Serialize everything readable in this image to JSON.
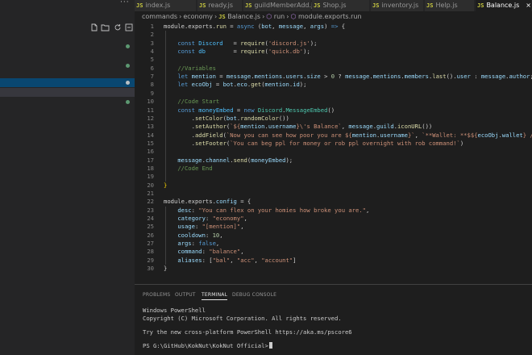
{
  "tabs": [
    {
      "label": "index.js",
      "active": false
    },
    {
      "label": "ready.js",
      "active": false
    },
    {
      "label": "guildMemberAdd.js",
      "active": false
    },
    {
      "label": "Shop.js",
      "active": false
    },
    {
      "label": "inventory.js",
      "active": false
    },
    {
      "label": "Help.js",
      "active": false
    },
    {
      "label": "Balance.js",
      "active": true
    }
  ],
  "tab_icon": "JS",
  "tab_close": "×",
  "sidebar": {
    "more_label": "···",
    "tools": [
      "new-file-icon",
      "new-folder-icon",
      "refresh-icon",
      "collapse-icon"
    ]
  },
  "breadcrumb": {
    "folder1": "commands",
    "folder2": "economy",
    "file": "Balance.js",
    "sym1": "run",
    "sym2": "module.exports.run",
    "sep": "›"
  },
  "editor": {
    "lines": [
      [
        [
          "t-plain",
          "module"
        ],
        [
          "t-punc",
          "."
        ],
        [
          "t-plain",
          "exports"
        ],
        [
          "t-punc",
          "."
        ],
        [
          "t-fn",
          "run"
        ],
        [
          "t-punc",
          " = "
        ],
        [
          "t-kw",
          "async"
        ],
        [
          "t-punc",
          " ("
        ],
        [
          "t-var",
          "bot"
        ],
        [
          "t-punc",
          ", "
        ],
        [
          "t-var",
          "message"
        ],
        [
          "t-punc",
          ", "
        ],
        [
          "t-var",
          "args"
        ],
        [
          "t-punc",
          ") "
        ],
        [
          "t-kw",
          "=>"
        ],
        [
          "t-punc",
          " {"
        ]
      ],
      [],
      [
        [
          "t-punc",
          "    "
        ],
        [
          "t-kw",
          "const"
        ],
        [
          "t-punc",
          " "
        ],
        [
          "t-const",
          "Discord"
        ],
        [
          "t-punc",
          "   = "
        ],
        [
          "t-fn",
          "require"
        ],
        [
          "t-punc",
          "("
        ],
        [
          "t-str",
          "'discord.js'"
        ],
        [
          "t-punc",
          ");"
        ]
      ],
      [
        [
          "t-punc",
          "    "
        ],
        [
          "t-kw",
          "const"
        ],
        [
          "t-punc",
          " "
        ],
        [
          "t-const",
          "db"
        ],
        [
          "t-punc",
          "        = "
        ],
        [
          "t-fn",
          "require"
        ],
        [
          "t-punc",
          "("
        ],
        [
          "t-str",
          "'quick.db'"
        ],
        [
          "t-punc",
          ");"
        ]
      ],
      [],
      [
        [
          "t-punc",
          "    "
        ],
        [
          "t-cmt",
          "//Variables"
        ]
      ],
      [
        [
          "t-punc",
          "    "
        ],
        [
          "t-kw",
          "let"
        ],
        [
          "t-punc",
          " "
        ],
        [
          "t-var",
          "mention"
        ],
        [
          "t-punc",
          " = "
        ],
        [
          "t-var",
          "message"
        ],
        [
          "t-punc",
          "."
        ],
        [
          "t-var",
          "mentions"
        ],
        [
          "t-punc",
          "."
        ],
        [
          "t-var",
          "users"
        ],
        [
          "t-punc",
          "."
        ],
        [
          "t-var",
          "size"
        ],
        [
          "t-punc",
          " > "
        ],
        [
          "t-num",
          "0"
        ],
        [
          "t-punc",
          " ? "
        ],
        [
          "t-var",
          "message"
        ],
        [
          "t-punc",
          "."
        ],
        [
          "t-var",
          "mentions"
        ],
        [
          "t-punc",
          "."
        ],
        [
          "t-var",
          "members"
        ],
        [
          "t-punc",
          "."
        ],
        [
          "t-fn",
          "last"
        ],
        [
          "t-punc",
          "()."
        ],
        [
          "t-var",
          "user"
        ],
        [
          "t-punc",
          " : "
        ],
        [
          "t-var",
          "message"
        ],
        [
          "t-punc",
          "."
        ],
        [
          "t-var",
          "author"
        ],
        [
          "t-punc",
          ";"
        ]
      ],
      [
        [
          "t-punc",
          "    "
        ],
        [
          "t-kw",
          "let"
        ],
        [
          "t-punc",
          " "
        ],
        [
          "t-var",
          "ecoObj"
        ],
        [
          "t-punc",
          " = "
        ],
        [
          "t-var",
          "bot"
        ],
        [
          "t-punc",
          "."
        ],
        [
          "t-var",
          "eco"
        ],
        [
          "t-punc",
          "."
        ],
        [
          "t-fn",
          "get"
        ],
        [
          "t-punc",
          "("
        ],
        [
          "t-var",
          "mention"
        ],
        [
          "t-punc",
          "."
        ],
        [
          "t-var",
          "id"
        ],
        [
          "t-punc",
          ");"
        ]
      ],
      [],
      [
        [
          "t-punc",
          "    "
        ],
        [
          "t-cmt",
          "//Code Start"
        ]
      ],
      [
        [
          "t-punc",
          "    "
        ],
        [
          "t-kw",
          "const"
        ],
        [
          "t-punc",
          " "
        ],
        [
          "t-const",
          "moneyEmbed"
        ],
        [
          "t-punc",
          " = "
        ],
        [
          "t-kw",
          "new"
        ],
        [
          "t-punc",
          " "
        ],
        [
          "t-cls",
          "Discord"
        ],
        [
          "t-punc",
          "."
        ],
        [
          "t-cls",
          "MessageEmbed"
        ],
        [
          "t-punc",
          "()"
        ]
      ],
      [
        [
          "t-punc",
          "        ."
        ],
        [
          "t-fn",
          "setColor"
        ],
        [
          "t-punc",
          "("
        ],
        [
          "t-var",
          "bot"
        ],
        [
          "t-punc",
          "."
        ],
        [
          "t-fn",
          "randomColor"
        ],
        [
          "t-punc",
          "())"
        ]
      ],
      [
        [
          "t-punc",
          "        ."
        ],
        [
          "t-fn",
          "setAuthor"
        ],
        [
          "t-punc",
          "("
        ],
        [
          "t-str",
          "`${"
        ],
        [
          "t-var",
          "mention"
        ],
        [
          "t-punc",
          "."
        ],
        [
          "t-var",
          "username"
        ],
        [
          "t-str",
          "}\\'s Balance`"
        ],
        [
          "t-punc",
          ", "
        ],
        [
          "t-var",
          "message"
        ],
        [
          "t-punc",
          "."
        ],
        [
          "t-var",
          "guild"
        ],
        [
          "t-punc",
          "."
        ],
        [
          "t-fn",
          "iconURL"
        ],
        [
          "t-punc",
          "())"
        ]
      ],
      [
        [
          "t-punc",
          "        ."
        ],
        [
          "t-fn",
          "addField"
        ],
        [
          "t-punc",
          "("
        ],
        [
          "t-str",
          "`Now you can see how poor you are ${"
        ],
        [
          "t-var",
          "mention"
        ],
        [
          "t-punc",
          "."
        ],
        [
          "t-var",
          "username"
        ],
        [
          "t-str",
          "}`"
        ],
        [
          "t-punc",
          ", "
        ],
        [
          "t-str",
          "`**Wallet: **$${"
        ],
        [
          "t-var",
          "ecoObj"
        ],
        [
          "t-punc",
          "."
        ],
        [
          "t-var",
          "wallet"
        ],
        [
          "t-str",
          "} / $${"
        ],
        [
          "t-var",
          "ec"
        ]
      ],
      [
        [
          "t-punc",
          "        ."
        ],
        [
          "t-fn",
          "setFooter"
        ],
        [
          "t-punc",
          "("
        ],
        [
          "t-str",
          "`You can beg ppl for money or rob ppl overnight with rob command!`"
        ],
        [
          "t-punc",
          ")"
        ]
      ],
      [],
      [
        [
          "t-punc",
          "    "
        ],
        [
          "t-var",
          "message"
        ],
        [
          "t-punc",
          "."
        ],
        [
          "t-var",
          "channel"
        ],
        [
          "t-punc",
          "."
        ],
        [
          "t-fn",
          "send"
        ],
        [
          "t-punc",
          "("
        ],
        [
          "t-var",
          "moneyEmbed"
        ],
        [
          "t-punc",
          ");"
        ]
      ],
      [
        [
          "t-punc",
          "    "
        ],
        [
          "t-cmt",
          "//Code End"
        ]
      ],
      [],
      [
        [
          "t-brk",
          "}"
        ]
      ],
      [],
      [
        [
          "t-plain",
          "module"
        ],
        [
          "t-punc",
          "."
        ],
        [
          "t-plain",
          "exports"
        ],
        [
          "t-punc",
          "."
        ],
        [
          "t-var",
          "config"
        ],
        [
          "t-punc",
          " = {"
        ]
      ],
      [
        [
          "t-punc",
          "    "
        ],
        [
          "t-var",
          "desc"
        ],
        [
          "t-punc",
          ": "
        ],
        [
          "t-str",
          "\"You can flex on your homies how broke you are.\""
        ],
        [
          "t-punc",
          ","
        ]
      ],
      [
        [
          "t-punc",
          "    "
        ],
        [
          "t-var",
          "category"
        ],
        [
          "t-punc",
          ": "
        ],
        [
          "t-str",
          "\"economy\""
        ],
        [
          "t-punc",
          ","
        ]
      ],
      [
        [
          "t-punc",
          "    "
        ],
        [
          "t-var",
          "usage"
        ],
        [
          "t-punc",
          ": "
        ],
        [
          "t-str",
          "\"[mention]\""
        ],
        [
          "t-punc",
          ","
        ]
      ],
      [
        [
          "t-punc",
          "    "
        ],
        [
          "t-var",
          "cooldown"
        ],
        [
          "t-punc",
          ": "
        ],
        [
          "t-num",
          "10"
        ],
        [
          "t-punc",
          ","
        ]
      ],
      [
        [
          "t-punc",
          "    "
        ],
        [
          "t-var",
          "args"
        ],
        [
          "t-punc",
          ": "
        ],
        [
          "t-kw",
          "false"
        ],
        [
          "t-punc",
          ","
        ]
      ],
      [
        [
          "t-punc",
          "    "
        ],
        [
          "t-var",
          "command"
        ],
        [
          "t-punc",
          ": "
        ],
        [
          "t-str",
          "\"balance\""
        ],
        [
          "t-punc",
          ","
        ]
      ],
      [
        [
          "t-punc",
          "    "
        ],
        [
          "t-var",
          "aliases"
        ],
        [
          "t-punc",
          ": ["
        ],
        [
          "t-str",
          "\"bal\""
        ],
        [
          "t-punc",
          ", "
        ],
        [
          "t-str",
          "\"acc\""
        ],
        [
          "t-punc",
          ", "
        ],
        [
          "t-str",
          "\"account\""
        ],
        [
          "t-punc",
          "]"
        ]
      ],
      [
        [
          "t-punc",
          "}"
        ]
      ]
    ]
  },
  "panel": {
    "tabs": [
      "PROBLEMS",
      "OUTPUT",
      "TERMINAL",
      "DEBUG CONSOLE"
    ],
    "active_tab": "TERMINAL",
    "terminal_lines": [
      "Windows PowerShell",
      "Copyright (C) Microsoft Corporation. All rights reserved.",
      "",
      "Try the new cross-platform PowerShell https://aka.ms/pscore6",
      "",
      "PS G:\\GitHub\\KokNut\\KokNut Official>"
    ]
  }
}
